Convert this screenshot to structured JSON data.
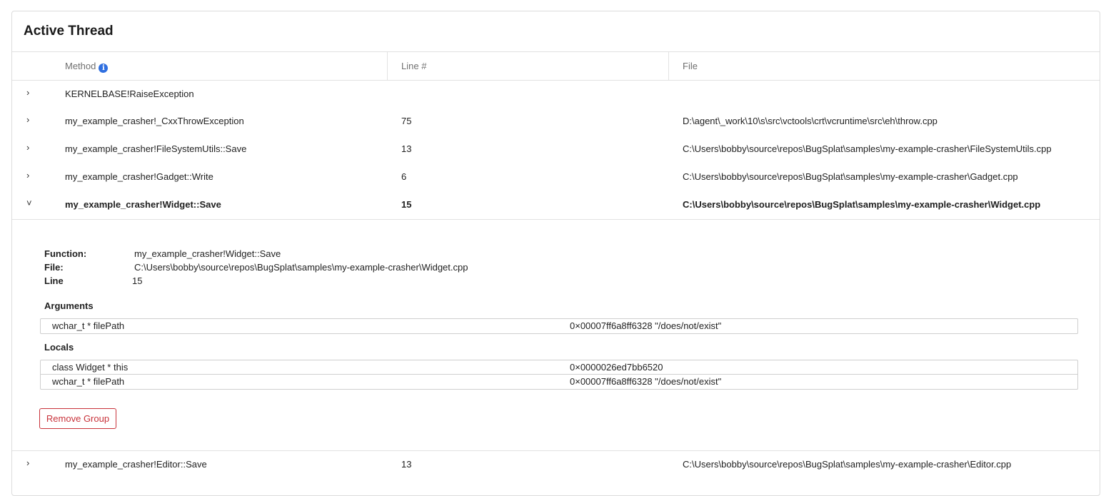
{
  "panel": {
    "title": "Active Thread"
  },
  "columns": {
    "method": "Method",
    "line": "Line #",
    "file": "File"
  },
  "rows": [
    {
      "chevron": "›",
      "method": "KERNELBASE!RaiseException",
      "line": "",
      "file": ""
    },
    {
      "chevron": "›",
      "method": "my_example_crasher!_CxxThrowException",
      "line": "75",
      "file": "D:\\agent\\_work\\10\\s\\src\\vctools\\crt\\vcruntime\\src\\eh\\throw.cpp"
    },
    {
      "chevron": "›",
      "method": "my_example_crasher!FileSystemUtils::Save",
      "line": "13",
      "file": "C:\\Users\\bobby\\source\\repos\\BugSplat\\samples\\my-example-crasher\\FileSystemUtils.cpp"
    },
    {
      "chevron": "›",
      "method": "my_example_crasher!Gadget::Write",
      "line": "6",
      "file": "C:\\Users\\bobby\\source\\repos\\BugSplat\\samples\\my-example-crasher\\Gadget.cpp"
    },
    {
      "chevron": "˅",
      "method": "my_example_crasher!Widget::Save",
      "line": "15",
      "file": "C:\\Users\\bobby\\source\\repos\\BugSplat\\samples\\my-example-crasher\\Widget.cpp"
    },
    {
      "chevron": "›",
      "method": "my_example_crasher!Editor::Save",
      "line": "13",
      "file": "C:\\Users\\bobby\\source\\repos\\BugSplat\\samples\\my-example-crasher\\Editor.cpp"
    }
  ],
  "details": {
    "function_label": "Function:",
    "function_value": "my_example_crasher!Widget::Save",
    "file_label": "File:",
    "file_value": "C:\\Users\\bobby\\source\\repos\\BugSplat\\samples\\my-example-crasher\\Widget.cpp",
    "line_label": "Line",
    "line_value": "15",
    "arguments_heading": "Arguments",
    "arguments": [
      {
        "name": "wchar_t * filePath",
        "value": "0×00007ff6a8ff6328 \"/does/not/exist\""
      }
    ],
    "locals_heading": "Locals",
    "locals": [
      {
        "name": "class Widget * this",
        "value": "0×0000026ed7bb6520"
      },
      {
        "name": "wchar_t * filePath",
        "value": "0×00007ff6a8ff6328 \"/does/not/exist\""
      }
    ],
    "remove_button": "Remove Group"
  },
  "colors": {
    "accent": "#2f6fe0",
    "danger": "#c8323a",
    "border": "#dcdcdc"
  },
  "icons": {
    "info": "info-icon",
    "expand": "chevron-right-icon",
    "collapse": "chevron-down-icon"
  }
}
